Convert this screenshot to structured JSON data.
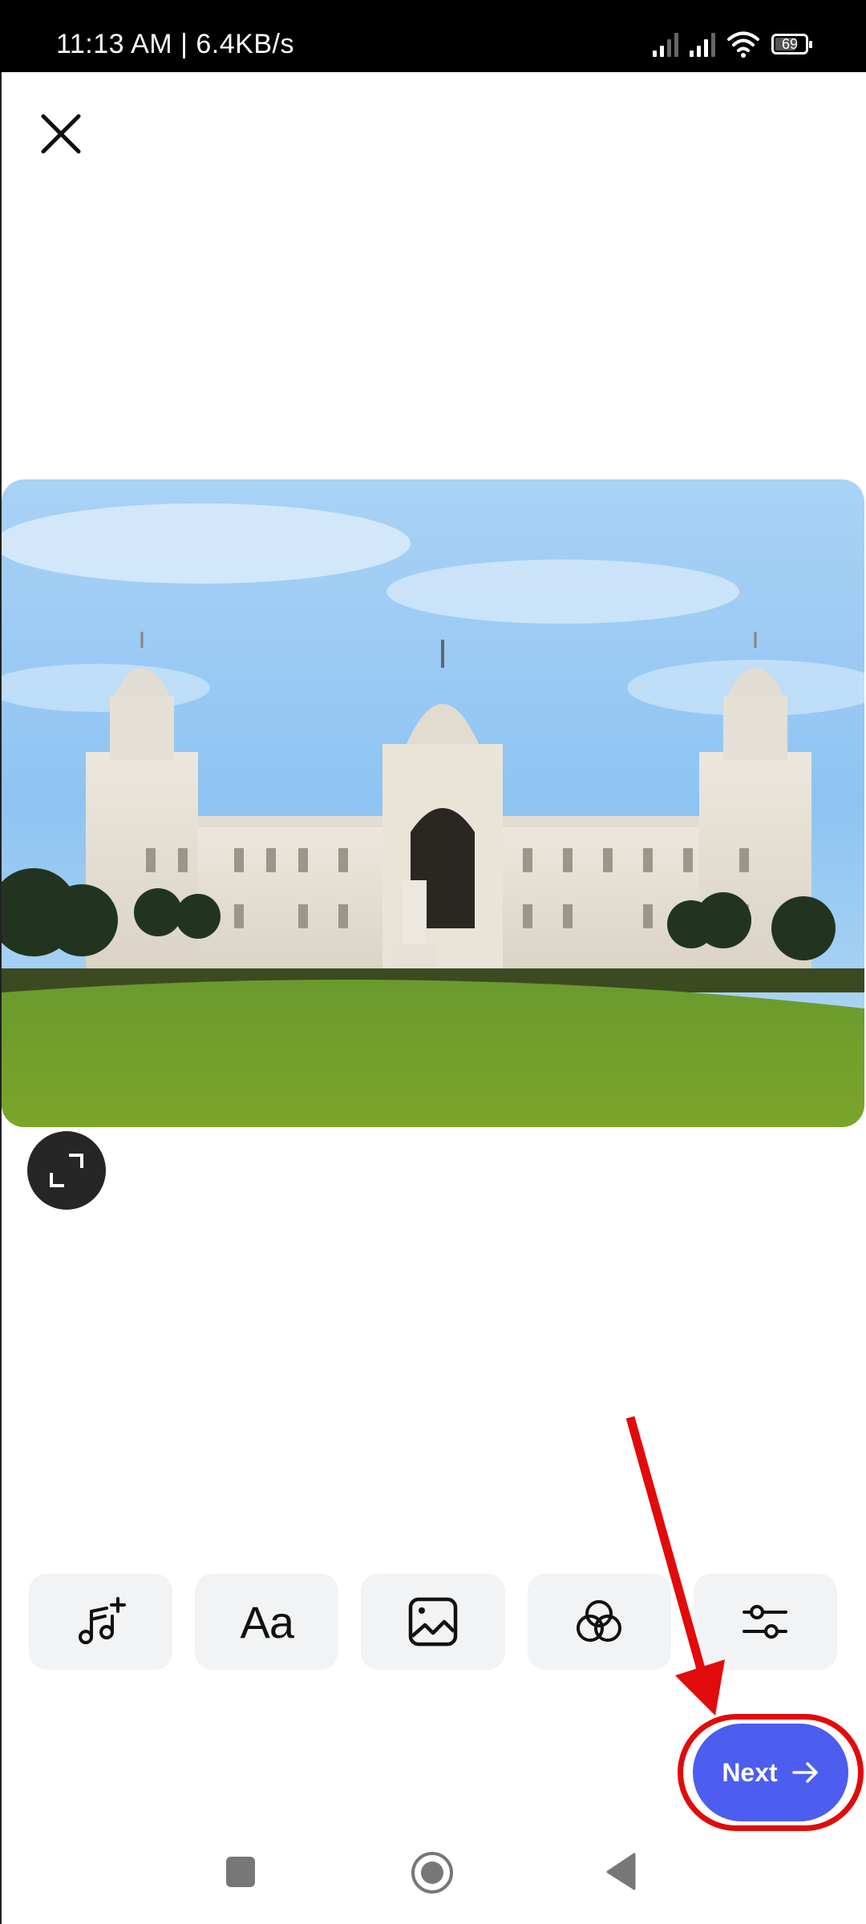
{
  "status_bar": {
    "time": "11:13 AM",
    "separator": "|",
    "network_speed": "6.4KB/s",
    "battery_level": "69",
    "icons": [
      "signal-icon",
      "signal-icon",
      "wifi-icon",
      "battery-icon"
    ]
  },
  "header": {
    "close_icon": "close-icon"
  },
  "media": {
    "description": "Photo of white marble palace with domes, statue and green lawn under blue sky",
    "expand_icon": "expand-icon"
  },
  "toolbar": {
    "items": [
      {
        "name": "add-music",
        "icon": "music-add-icon"
      },
      {
        "name": "text",
        "icon": "text-icon",
        "label": "Aa"
      },
      {
        "name": "image",
        "icon": "image-icon"
      },
      {
        "name": "filters",
        "icon": "filter-icon"
      },
      {
        "name": "adjust",
        "icon": "sliders-icon"
      }
    ]
  },
  "next_button": {
    "label": "Next",
    "icon": "arrow-right-icon",
    "color": "#4c5df0"
  },
  "annotation": {
    "color": "#e20a0a"
  },
  "nav_bar": {
    "items": [
      "recents-icon",
      "home-icon",
      "back-icon"
    ]
  }
}
